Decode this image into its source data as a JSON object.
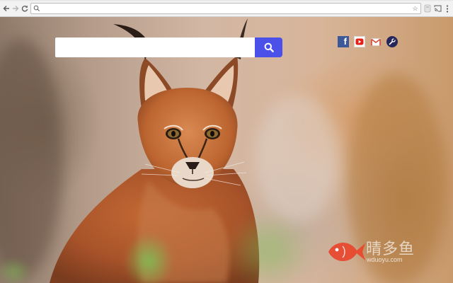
{
  "browser": {
    "nav": {
      "back_icon": "back-arrow-icon",
      "forward_icon": "forward-arrow-icon",
      "reload_icon": "reload-icon"
    },
    "omnibox": {
      "value": "",
      "placeholder": "",
      "search_icon": "search-icon",
      "bookmark_icon": "star-icon"
    },
    "extensions": [
      "extension-icon",
      "cast-icon",
      "menu-icon"
    ]
  },
  "newtab": {
    "search": {
      "value": "",
      "placeholder": "",
      "button_icon": "search-icon",
      "button_color": "#4b50e8"
    },
    "quick_links": [
      {
        "name": "facebook",
        "icon": "facebook-icon",
        "glyph": "f",
        "color": "#3b5998"
      },
      {
        "name": "youtube",
        "icon": "youtube-icon",
        "color": "#e62117"
      },
      {
        "name": "gmail",
        "icon": "gmail-icon",
        "color": "#d44638"
      },
      {
        "name": "tools",
        "icon": "wrench-icon",
        "color": "#26265a"
      }
    ],
    "background": "caracal photo"
  },
  "watermark": {
    "name": "晴多鱼",
    "url": "wduoyu.com",
    "logo_color": "#e8472c"
  }
}
